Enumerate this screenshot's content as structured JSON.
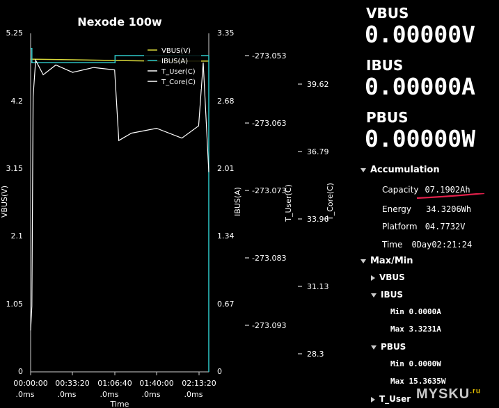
{
  "chart": {
    "title": "Nexode 100w",
    "left_axis": {
      "label": "VBUS(V)",
      "ticks": [
        "5.25",
        "4.2",
        "3.15",
        "2.1",
        "1.05",
        "0"
      ]
    },
    "right_axis": {
      "label": "IBUS(A)",
      "ticks": [
        "3.35",
        "2.68",
        "2.01",
        "1.34",
        "0.67",
        "0"
      ]
    },
    "tuser_axis": {
      "label": "T_User(C)",
      "ticks": [
        "-273.053",
        "-273.063",
        "-273.073",
        "-273.083",
        "-273.093"
      ]
    },
    "tcore_axis": {
      "label": "T_Core(C)",
      "ticks": [
        "39.62",
        "36.79",
        "33.96",
        "31.13",
        "28.3"
      ]
    },
    "x_axis": {
      "label": "Time",
      "ticks_time": [
        "00:00:00",
        "00:33:20",
        "01:06:40",
        "01:40:00",
        "02:13:20"
      ],
      "ticks_ms": [
        ".0ms",
        ".0ms",
        ".0ms",
        ".0ms",
        ".0ms"
      ]
    },
    "legend": [
      {
        "name": "VBUS(V)",
        "color": "#d8d83a"
      },
      {
        "name": "IBUS(A)",
        "color": "#2ec8c8"
      },
      {
        "name": "T_User(C)",
        "color": "#ffffff"
      },
      {
        "name": "T_Core(C)",
        "color": "#ffffff"
      }
    ]
  },
  "chart_data": {
    "type": "line",
    "title": "Nexode 100w",
    "xlabel": "Time",
    "x_ticks": [
      "00:00:00",
      "00:33:20",
      "01:06:40",
      "01:40:00",
      "02:13:20"
    ],
    "xlim": [
      "00:00:00",
      "02:21:24"
    ],
    "legend_position": "top-right",
    "grid": false,
    "series": [
      {
        "name": "VBUS(V)",
        "axis": "VBUS(V)",
        "ylim": [
          0,
          5.25
        ],
        "color": "#d8d83a",
        "x": [
          "00:00:00",
          "00:33:20",
          "01:06:40",
          "01:40:00",
          "02:13:20",
          "02:21:24"
        ],
        "values": [
          4.85,
          4.84,
          4.83,
          4.82,
          4.82,
          4.82
        ]
      },
      {
        "name": "IBUS(A)",
        "axis": "IBUS(A)",
        "ylim": [
          0,
          3.35
        ],
        "color": "#2ec8c8",
        "x": [
          "00:00:00",
          "00:01:00",
          "00:33:20",
          "01:06:00",
          "01:07:00",
          "01:40:00",
          "02:13:20",
          "02:21:24"
        ],
        "values": [
          3.2,
          3.06,
          3.06,
          3.06,
          3.13,
          3.13,
          3.13,
          0
        ]
      },
      {
        "name": "T_Core(C)",
        "axis": "T_Core(C)",
        "ylim": [
          28.3,
          42.2
        ],
        "color": "#ffffff",
        "x": [
          "00:00:00",
          "00:01:00",
          "00:02:00",
          "00:04:00",
          "00:10:00",
          "00:20:00",
          "00:33:20",
          "00:50:00",
          "01:06:40",
          "01:10:00",
          "01:20:00",
          "01:40:00",
          "02:00:00",
          "02:13:20",
          "02:17:00",
          "02:21:24"
        ],
        "values": [
          30.0,
          31.0,
          39.6,
          41.1,
          40.5,
          40.9,
          40.6,
          40.8,
          40.7,
          37.8,
          38.1,
          38.3,
          37.9,
          38.4,
          41.0,
          36.5
        ]
      }
    ]
  },
  "readout": {
    "vbus_label": "VBUS",
    "vbus_value": "0.00000V",
    "ibus_label": "IBUS",
    "ibus_value": "0.00000A",
    "pbus_label": "PBUS",
    "pbus_value": "0.00000W"
  },
  "accumulation": {
    "title": "Accumulation",
    "capacity_label": "Capacity",
    "capacity_value": "07.1902Ah",
    "energy_label": "Energy",
    "energy_value": "34.3206Wh",
    "platform_label": "Platform",
    "platform_value": "04.7732V",
    "time_label": "Time",
    "time_value": "0Day02:21:24"
  },
  "maxmin": {
    "title": "Max/Min",
    "vbus": "VBUS",
    "ibus": "IBUS",
    "ibus_min": "Min 0.0000A",
    "ibus_max": "Max 3.3231A",
    "pbus": "PBUS",
    "pbus_min": "Min 0.0000W",
    "pbus_max": "Max 15.3635W",
    "tuser": "T_User"
  },
  "watermark": {
    "text": "MYSKU",
    "suffix": ".ru"
  },
  "colors": {
    "vbus": "#d8d83a",
    "ibus": "#2ec8c8",
    "temp": "#ffffff",
    "underline": "#e0204a"
  }
}
